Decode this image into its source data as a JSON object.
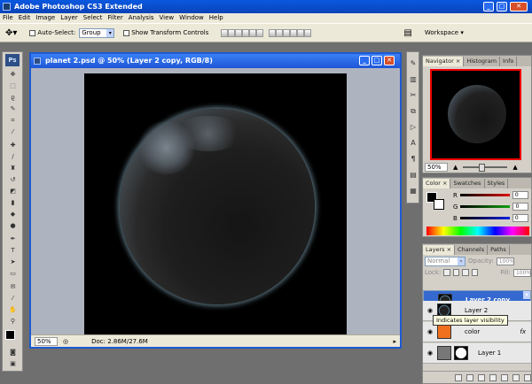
{
  "app": {
    "title": "Adobe Photoshop CS3 Extended",
    "logo": "Ps"
  },
  "menu": [
    "File",
    "Edit",
    "Image",
    "Layer",
    "Select",
    "Filter",
    "Analysis",
    "View",
    "Window",
    "Help"
  ],
  "options_bar": {
    "auto_select_label": "Auto-Select:",
    "auto_select_value": "Group",
    "show_transform_label": "Show Transform Controls",
    "workspace_label": "Workspace ▾"
  },
  "document": {
    "title": "planet 2.psd @ 50% (Layer 2 copy, RGB/8)",
    "zoom": "50%",
    "doc_size": "Doc: 2.86M/27.6M"
  },
  "navigator": {
    "tabs": [
      "Navigator ×",
      "Histogram",
      "Info"
    ],
    "zoom": "50%"
  },
  "color_panel": {
    "tabs": [
      "Color ×",
      "Swatches",
      "Styles"
    ],
    "channels": [
      {
        "label": "R",
        "value": "0",
        "color": "#e01010"
      },
      {
        "label": "G",
        "value": "0",
        "color": "#10a010"
      },
      {
        "label": "B",
        "value": "0",
        "color": "#1020e0"
      }
    ]
  },
  "layers_panel": {
    "tabs": [
      "Layers ×",
      "Channels",
      "Paths"
    ],
    "blend_mode": "Normal",
    "opacity_label": "Opacity:",
    "opacity_value": "100%",
    "lock_label": "Lock:",
    "fill_label": "Fill:",
    "fill_value": "100%",
    "layers": [
      {
        "name": "Layer 2 copy",
        "selected": true,
        "visible": false
      },
      {
        "name": "Layer 2",
        "selected": false,
        "visible": true
      },
      {
        "name": "color",
        "selected": false,
        "visible": true,
        "fx": "fx"
      },
      {
        "name": "Layer 1",
        "selected": false,
        "visible": true
      }
    ],
    "tooltip": "Indicates layer visibility"
  },
  "colors": {
    "titlebar": "#0b4ed0",
    "selected_layer": "#3569cf",
    "color_layer_thumb": "#f07020"
  }
}
